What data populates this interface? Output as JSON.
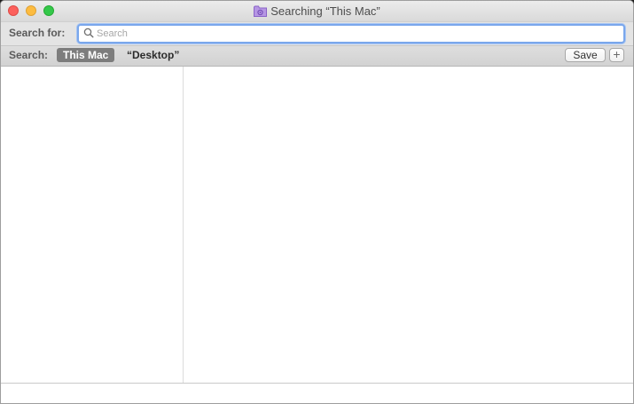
{
  "window": {
    "title": "Searching “This Mac”",
    "title_icon": "smart-folder-icon"
  },
  "search_bar": {
    "label": "Search for:",
    "placeholder": "Search",
    "value": ""
  },
  "scope_bar": {
    "label": "Search:",
    "scopes": [
      "This Mac",
      "“Desktop”"
    ],
    "selected": "This Mac",
    "save_label": "Save",
    "add_label": "+"
  },
  "colors": {
    "close": "#fc605c",
    "minimize": "#fdbc40",
    "zoom": "#34c84a",
    "focus_ring": "#7aa7ec",
    "selected_scope": "#7d7d7d",
    "smart_folder": "#a77fd8"
  }
}
